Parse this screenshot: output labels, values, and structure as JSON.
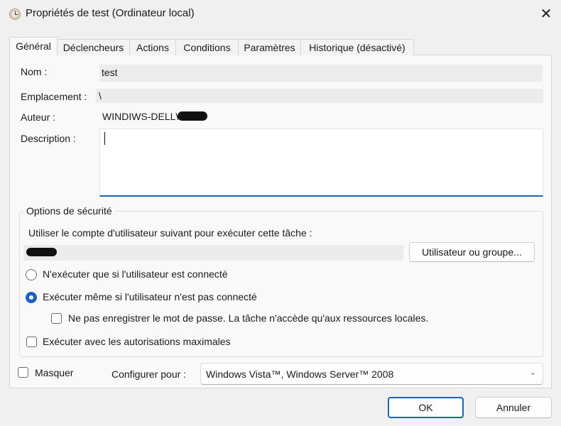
{
  "window": {
    "title": "Propriétés de test (Ordinateur local)",
    "close_glyph": "✕",
    "icon": "task-scheduler-clock-icon"
  },
  "tabs": [
    {
      "label": "Général",
      "active": true
    },
    {
      "label": "Déclencheurs"
    },
    {
      "label": "Actions"
    },
    {
      "label": "Conditions"
    },
    {
      "label": "Paramètres"
    },
    {
      "label": "Historique (désactivé)"
    }
  ],
  "general": {
    "name_label": "Nom :",
    "name_value": "test",
    "location_label": "Emplacement :",
    "location_value": "\\",
    "author_label": "Auteur :",
    "author_value": "WINDIWS-DELL\\",
    "description_label": "Description :",
    "description_value": ""
  },
  "security": {
    "title": "Options de sécurité",
    "account_prompt": "Utiliser le compte d'utilisateur suivant pour exécuter cette tâche :",
    "user_group_button": "Utilisateur ou groupe...",
    "radio_logged_on": "N'exécuter que si l'utilisateur est connecté",
    "radio_logged_on_selected": false,
    "radio_always": "Exécuter même si l'utilisateur n'est pas connecté",
    "radio_always_selected": true,
    "do_not_store_password": "Ne pas enregistrer le mot de passe. La tâche n'accède qu'aux ressources locales.",
    "do_not_store_password_checked": false,
    "highest_privileges": "Exécuter avec les autorisations maximales",
    "highest_privileges_checked": false
  },
  "footer": {
    "hidden_label": "Masquer",
    "hidden_checked": false,
    "configure_label": "Configurer pour :",
    "configure_value": "Windows Vista™, Windows Server™ 2008"
  },
  "buttons": {
    "ok": "OK",
    "cancel": "Annuler"
  },
  "colors": {
    "accent": "#1664c0",
    "focus_border": "#1e64b4"
  }
}
